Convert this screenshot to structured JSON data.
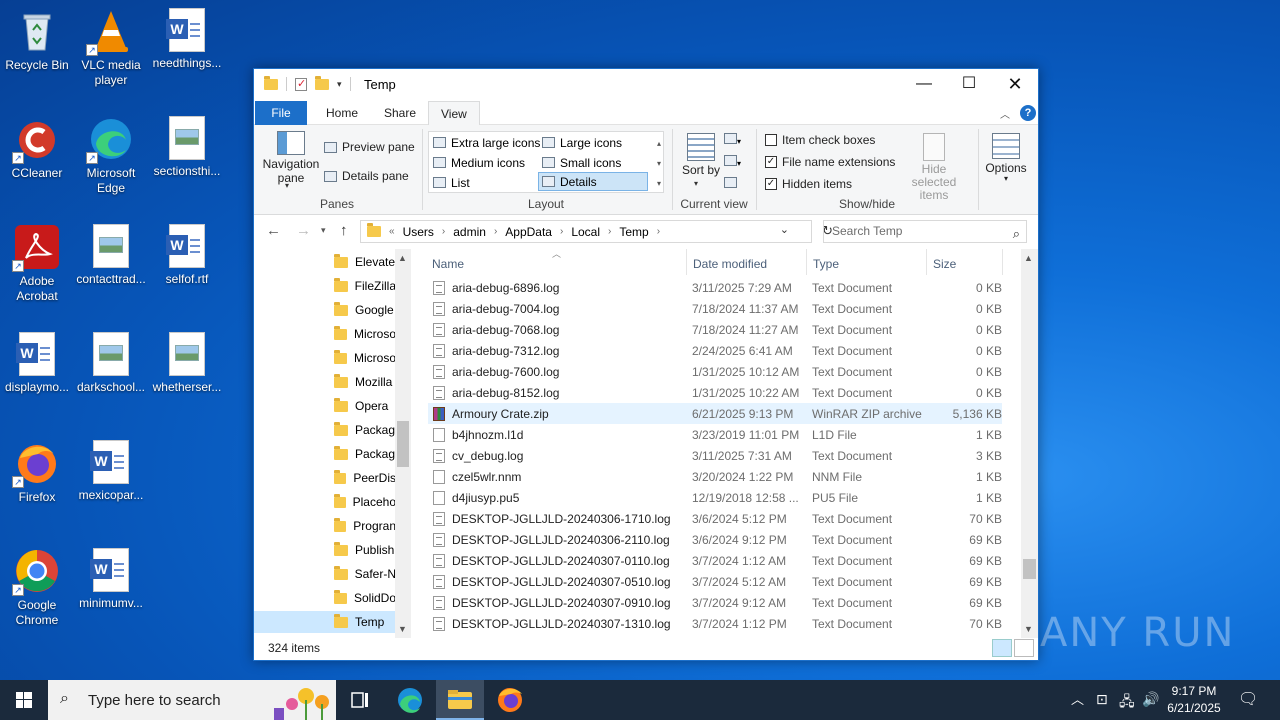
{
  "desktop": {
    "icons": [
      {
        "label": "Recycle Bin"
      },
      {
        "label": "VLC media player"
      },
      {
        "label": "needthings..."
      },
      {
        "label": "CCleaner"
      },
      {
        "label": "Microsoft Edge"
      },
      {
        "label": "sectionsthi..."
      },
      {
        "label": "Adobe Acrobat"
      },
      {
        "label": "contacttrad..."
      },
      {
        "label": "selfof.rtf"
      },
      {
        "label": "displaymo..."
      },
      {
        "label": "darkschool..."
      },
      {
        "label": "whetherser..."
      },
      {
        "label": "Firefox"
      },
      {
        "label": "mexicopar..."
      },
      {
        "label": "Google Chrome"
      },
      {
        "label": "minimumv..."
      }
    ],
    "watermark": "ANY RUN"
  },
  "window": {
    "title": "Temp",
    "tabs": {
      "file": "File",
      "home": "Home",
      "share": "Share",
      "view": "View"
    },
    "ribbon": {
      "panes": {
        "nav_pane": "Navigation pane",
        "preview_pane": "Preview pane",
        "details_pane": "Details pane",
        "group": "Panes"
      },
      "layout": {
        "extra_large": "Extra large icons",
        "large": "Large icons",
        "medium": "Medium icons",
        "small": "Small icons",
        "list": "List",
        "details": "Details",
        "group": "Layout"
      },
      "current_view": {
        "sort_by": "Sort by",
        "group": "Current view"
      },
      "show_hide": {
        "item_check_boxes": "Item check boxes",
        "file_name_extensions": "File name extensions",
        "hidden_items": "Hidden items",
        "hide_selected": "Hide selected items",
        "group": "Show/hide",
        "item_check_boxes_checked": false,
        "file_name_extensions_checked": true,
        "hidden_items_checked": true
      },
      "options": "Options"
    },
    "address": {
      "crumbs": [
        "Users",
        "admin",
        "AppData",
        "Local",
        "Temp"
      ],
      "prefix": "«",
      "search_placeholder": "Search Temp"
    },
    "nav_pane": [
      "Elevate",
      "FileZilla",
      "Google",
      "Microso",
      "Microso",
      "Mozilla",
      "Opera",
      "Packag",
      "Packag",
      "PeerDis",
      "Placeho",
      "Progran",
      "Publish",
      "Safer-N",
      "SolidDo",
      "Temp"
    ],
    "columns": {
      "name": "Name",
      "date": "Date modified",
      "type": "Type",
      "size": "Size"
    },
    "files": [
      {
        "name": "aria-debug-6896.log",
        "date": "3/11/2025 7:29 AM",
        "type": "Text Document",
        "size": "0 KB",
        "kind": "txt"
      },
      {
        "name": "aria-debug-7004.log",
        "date": "7/18/2024 11:37 AM",
        "type": "Text Document",
        "size": "0 KB",
        "kind": "txt"
      },
      {
        "name": "aria-debug-7068.log",
        "date": "7/18/2024 11:27 AM",
        "type": "Text Document",
        "size": "0 KB",
        "kind": "txt"
      },
      {
        "name": "aria-debug-7312.log",
        "date": "2/24/2025 6:41 AM",
        "type": "Text Document",
        "size": "0 KB",
        "kind": "txt"
      },
      {
        "name": "aria-debug-7600.log",
        "date": "1/31/2025 10:12 AM",
        "type": "Text Document",
        "size": "0 KB",
        "kind": "txt"
      },
      {
        "name": "aria-debug-8152.log",
        "date": "1/31/2025 10:22 AM",
        "type": "Text Document",
        "size": "0 KB",
        "kind": "txt"
      },
      {
        "name": "Armoury Crate.zip",
        "date": "6/21/2025 9:13 PM",
        "type": "WinRAR ZIP archive",
        "size": "5,136 KB",
        "kind": "zip"
      },
      {
        "name": "b4jhnozm.l1d",
        "date": "3/23/2019 11:01 PM",
        "type": "L1D File",
        "size": "1 KB",
        "kind": "blank"
      },
      {
        "name": "cv_debug.log",
        "date": "3/11/2025 7:31 AM",
        "type": "Text Document",
        "size": "3 KB",
        "kind": "txt"
      },
      {
        "name": "czel5wlr.nnm",
        "date": "3/20/2024 1:22 PM",
        "type": "NNM File",
        "size": "1 KB",
        "kind": "blank"
      },
      {
        "name": "d4jiusyp.pu5",
        "date": "12/19/2018 12:58 ...",
        "type": "PU5 File",
        "size": "1 KB",
        "kind": "blank"
      },
      {
        "name": "DESKTOP-JGLLJLD-20240306-1710.log",
        "date": "3/6/2024 5:12 PM",
        "type": "Text Document",
        "size": "70 KB",
        "kind": "txt"
      },
      {
        "name": "DESKTOP-JGLLJLD-20240306-2110.log",
        "date": "3/6/2024 9:12 PM",
        "type": "Text Document",
        "size": "69 KB",
        "kind": "txt"
      },
      {
        "name": "DESKTOP-JGLLJLD-20240307-0110.log",
        "date": "3/7/2024 1:12 AM",
        "type": "Text Document",
        "size": "69 KB",
        "kind": "txt"
      },
      {
        "name": "DESKTOP-JGLLJLD-20240307-0510.log",
        "date": "3/7/2024 5:12 AM",
        "type": "Text Document",
        "size": "69 KB",
        "kind": "txt"
      },
      {
        "name": "DESKTOP-JGLLJLD-20240307-0910.log",
        "date": "3/7/2024 9:12 AM",
        "type": "Text Document",
        "size": "69 KB",
        "kind": "txt"
      },
      {
        "name": "DESKTOP-JGLLJLD-20240307-1310.log",
        "date": "3/7/2024 1:12 PM",
        "type": "Text Document",
        "size": "70 KB",
        "kind": "txt"
      }
    ],
    "status": {
      "count": "324 items"
    }
  },
  "taskbar": {
    "search_placeholder": "Type here to search",
    "time": "9:17 PM",
    "date": "6/21/2025"
  }
}
